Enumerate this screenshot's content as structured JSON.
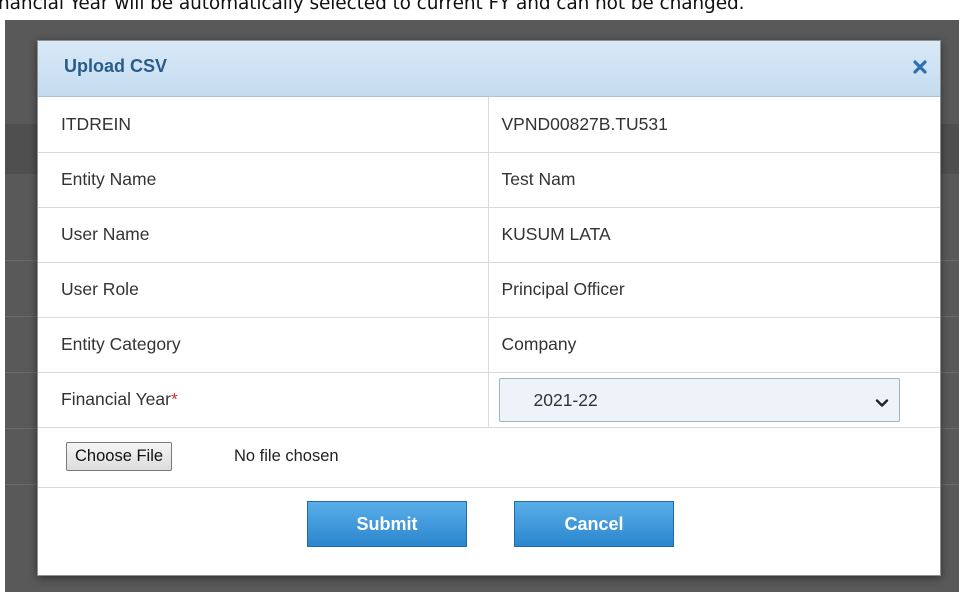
{
  "instruction_text": "nancial Year will be automatically selected to current FY and can not be changed.",
  "modal": {
    "title": "Upload CSV",
    "close_icon": "close-icon",
    "rows": [
      {
        "label": "ITDREIN",
        "value": "VPND00827B.TU531"
      },
      {
        "label": "Entity Name",
        "value": "Test Nam"
      },
      {
        "label": "User Name",
        "value": "KUSUM LATA"
      },
      {
        "label": "User Role",
        "value": "Principal Officer"
      },
      {
        "label": "Entity Category",
        "value": "Company"
      }
    ],
    "financial_year": {
      "label": "Financial Year",
      "required_marker": "*",
      "selected": "2021-22"
    },
    "file_input": {
      "button_label": "Choose File",
      "status": "No file chosen"
    },
    "buttons": {
      "submit": "Submit",
      "cancel": "Cancel"
    }
  },
  "colors": {
    "header_bg": "#c4dcf0",
    "title": "#2a5c8a",
    "primary_button": "#2b86cd",
    "required": "#d9302b",
    "backdrop": "#595959"
  }
}
